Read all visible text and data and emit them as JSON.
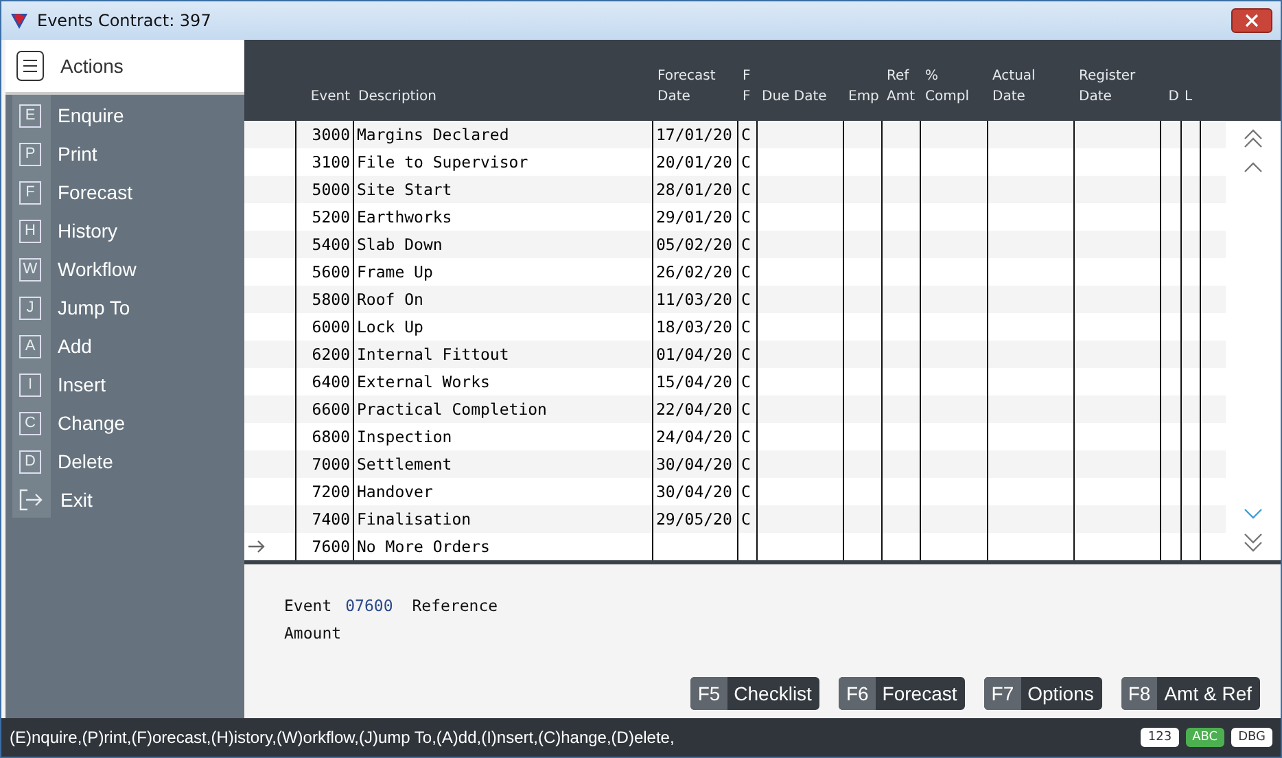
{
  "window": {
    "title": "Events  Contract: 397"
  },
  "actions": {
    "title": "Actions",
    "items": [
      {
        "kind": "key",
        "key": "E",
        "label": "Enquire"
      },
      {
        "kind": "key",
        "key": "P",
        "label": "Print"
      },
      {
        "kind": "key",
        "key": "F",
        "label": "Forecast"
      },
      {
        "kind": "key",
        "key": "H",
        "label": "History"
      },
      {
        "kind": "key",
        "key": "W",
        "label": "Workflow"
      },
      {
        "kind": "key",
        "key": "J",
        "label": "Jump To"
      },
      {
        "kind": "key",
        "key": "A",
        "label": "Add"
      },
      {
        "kind": "key",
        "key": "I",
        "label": "Insert"
      },
      {
        "kind": "key",
        "key": "C",
        "label": "Change"
      },
      {
        "kind": "key",
        "key": "D",
        "label": "Delete"
      },
      {
        "kind": "exit",
        "label": "Exit"
      }
    ]
  },
  "table": {
    "columns": [
      {},
      {},
      {
        "lines": [
          "Event"
        ]
      },
      {
        "lines": [
          "Description"
        ]
      },
      {
        "lines": [
          "Forecast",
          "Date"
        ]
      },
      {
        "lines": [
          "F",
          "F"
        ]
      },
      {
        "lines": [
          "Due Date"
        ]
      },
      {
        "lines": [
          "Emp"
        ]
      },
      {
        "lines": [
          "Ref",
          "Amt"
        ]
      },
      {
        "lines": [
          "%",
          "Compl"
        ]
      },
      {
        "lines": [
          "Actual",
          "Date"
        ]
      },
      {
        "lines": [
          "Register",
          "Date"
        ]
      },
      {
        "lines": [
          "D"
        ]
      },
      {
        "lines": [
          "L"
        ]
      },
      {}
    ],
    "rows": [
      {
        "selected": false,
        "event": "3000",
        "description": "Margins Declared",
        "forecast_date": "17/01/20",
        "ff": "C"
      },
      {
        "selected": false,
        "event": "3100",
        "description": "File to Supervisor",
        "forecast_date": "20/01/20",
        "ff": "C"
      },
      {
        "selected": false,
        "event": "5000",
        "description": "Site Start",
        "forecast_date": "28/01/20",
        "ff": "C"
      },
      {
        "selected": false,
        "event": "5200",
        "description": "Earthworks",
        "forecast_date": "29/01/20",
        "ff": "C"
      },
      {
        "selected": false,
        "event": "5400",
        "description": "Slab Down",
        "forecast_date": "05/02/20",
        "ff": "C"
      },
      {
        "selected": false,
        "event": "5600",
        "description": "Frame Up",
        "forecast_date": "26/02/20",
        "ff": "C"
      },
      {
        "selected": false,
        "event": "5800",
        "description": "Roof On",
        "forecast_date": "11/03/20",
        "ff": "C"
      },
      {
        "selected": false,
        "event": "6000",
        "description": "Lock Up",
        "forecast_date": "18/03/20",
        "ff": "C"
      },
      {
        "selected": false,
        "event": "6200",
        "description": "Internal Fittout",
        "forecast_date": "01/04/20",
        "ff": "C"
      },
      {
        "selected": false,
        "event": "6400",
        "description": "External Works",
        "forecast_date": "15/04/20",
        "ff": "C"
      },
      {
        "selected": false,
        "event": "6600",
        "description": "Practical Completion",
        "forecast_date": "22/04/20",
        "ff": "C"
      },
      {
        "selected": false,
        "event": "6800",
        "description": "Inspection",
        "forecast_date": "24/04/20",
        "ff": "C"
      },
      {
        "selected": false,
        "event": "7000",
        "description": "Settlement",
        "forecast_date": "30/04/20",
        "ff": "C"
      },
      {
        "selected": false,
        "event": "7200",
        "description": "Handover",
        "forecast_date": "30/04/20",
        "ff": "C"
      },
      {
        "selected": false,
        "event": "7400",
        "description": "Finalisation",
        "forecast_date": "29/05/20",
        "ff": "C"
      },
      {
        "selected": true,
        "event": "7600",
        "description": "No More Orders"
      }
    ]
  },
  "detail": {
    "event_label": "Event",
    "event_value": "07600",
    "reference_label": "Reference",
    "amount_label": "Amount"
  },
  "function_keys": [
    {
      "key": "F5",
      "label": "Checklist"
    },
    {
      "key": "F6",
      "label": "Forecast"
    },
    {
      "key": "F7",
      "label": "Options"
    },
    {
      "key": "F8",
      "label": "Amt & Ref"
    }
  ],
  "status_bar": {
    "text": "(E)nquire,(P)rint,(F)orecast,(H)istory,(W)orkflow,(J)ump To,(A)dd,(I)nsert,(C)hange,(D)elete,",
    "indicators": [
      {
        "label": "123",
        "active": false
      },
      {
        "label": "ABC",
        "active": true
      },
      {
        "label": "DBG",
        "active": false
      }
    ]
  }
}
